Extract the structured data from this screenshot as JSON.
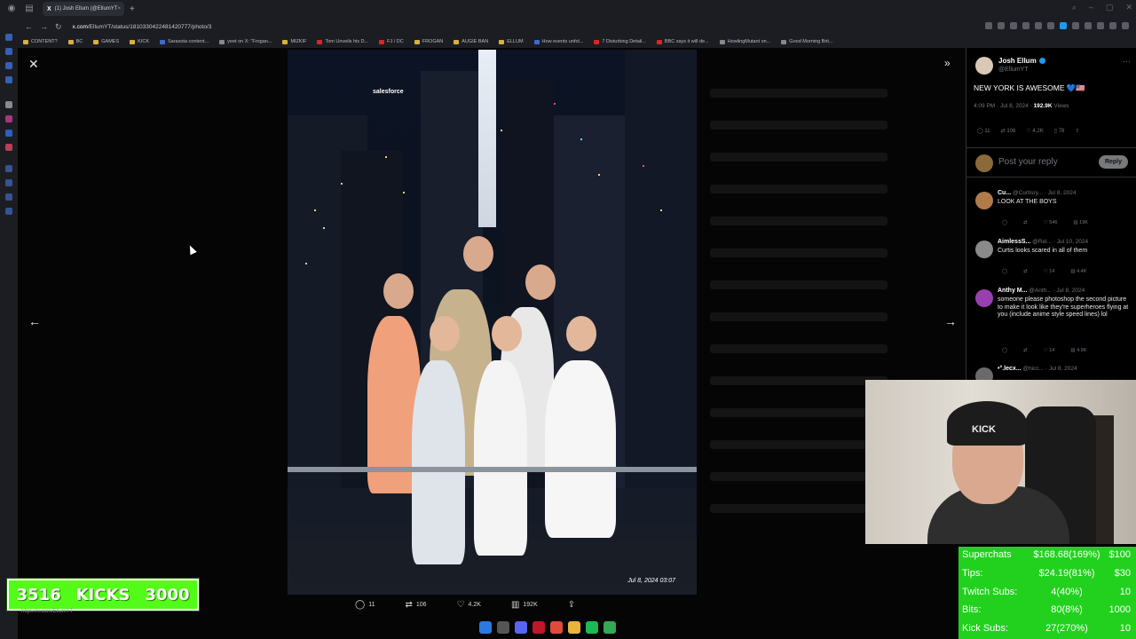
{
  "browser": {
    "tab_title": "(1) Josh Ellum (@EllumYT",
    "url_domain": "x.com",
    "url_path": "/EllumYT/status/1810330422481420777/photo/3",
    "bookmarks": [
      "CONTENT?",
      "BC",
      "GAMES",
      "KICK",
      "Sarasota content...",
      "yeet on X: \"Frogan...",
      "MIZKIF",
      "Tom Unveils his D...",
      "FJ / DC",
      "FROGAN",
      "AUGIE BAN",
      "ELLUM",
      "How events unfol...",
      "7 Disturbing Detail...",
      "BBC says it will de...",
      "HowlingMutant on...",
      "Good Morning Brit..."
    ],
    "status_url": "https://x.com/EllumYT"
  },
  "viewer": {
    "photo_timestamp": "Jul 8, 2024 03:07",
    "billboard_text": "salesforce",
    "actions": {
      "replies": "11",
      "reposts": "106",
      "likes": "4.2K",
      "views": "192K"
    }
  },
  "tweet": {
    "author_name": "Josh Ellum",
    "author_handle": "@EllumYT",
    "text": "NEW YORK IS AWESOME 💙🇺🇸",
    "time": "4:09 PM · Jul 8, 2024 · ",
    "views_count": "192.9K",
    "views_label": " Views",
    "stats": {
      "replies": "11",
      "reposts": "106",
      "likes": "4.2K",
      "bookmarks": "78"
    },
    "reply_placeholder": "Post your reply",
    "reply_button": "Reply"
  },
  "comments": [
    {
      "name": "Cu...",
      "handle": "@Curtisry... · Jul 8, 2024",
      "text": "LOOK AT THE BOYS",
      "likes": "546",
      "views": "19K",
      "color": "#b07a4a"
    },
    {
      "name": "AimlessS...",
      "handle": "@Rel... · Jul 10, 2024",
      "text": "Curtis looks scared in all of them",
      "likes": "14",
      "views": "4.4K",
      "color": "#8a8a8a"
    },
    {
      "name": "Anthy M...",
      "handle": "@Anth... · Jul 8, 2024",
      "text": "someone please photoshop the second picture to make it look like they're superheroes flying at you (include anime style speed lines) lol",
      "likes": "14",
      "views": "4.9K",
      "color": "#9a3fb0"
    },
    {
      "name": "•°.lecx...",
      "handle": "@hicc... · Jul 8, 2024",
      "text": "",
      "likes": "",
      "views": "",
      "color": "#6a6a6a"
    }
  ],
  "webcam": {
    "cap_text": "KICK"
  },
  "stream_stats": {
    "rows": [
      {
        "label": "Superchats",
        "value": "$168.68(169%)",
        "goal": "$100"
      },
      {
        "label": "Tips:",
        "value": "$24.19(81%)",
        "goal": "$30"
      },
      {
        "label": "Twitch Subs:",
        "value": "4(40%)",
        "goal": "10"
      },
      {
        "label": "Bits:",
        "value": "80(8%)",
        "goal": "1000"
      },
      {
        "label": "Kick Subs:",
        "value": "27(270%)",
        "goal": "10"
      }
    ]
  },
  "kicks": {
    "count": "3516",
    "label": "KICKS",
    "goal": "3000"
  },
  "colors": {
    "kick_green": "#53fc18",
    "stats_green": "#22d11e",
    "x_blue": "#1d9bf0"
  }
}
